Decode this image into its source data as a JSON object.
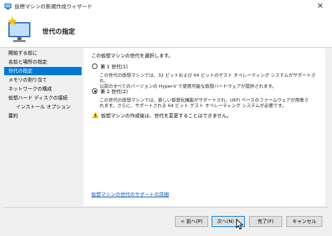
{
  "window": {
    "title": "仮想マシンの新規作成ウィザード",
    "close": "✕"
  },
  "header": {
    "title": "世代の指定"
  },
  "sidebar": {
    "items": [
      {
        "label": "開始する前に"
      },
      {
        "label": "名前と場所の指定"
      },
      {
        "label": "世代の指定"
      },
      {
        "label": "メモリの割り当て"
      },
      {
        "label": "ネットワークの構成"
      },
      {
        "label": "仮想ハード ディスクの接続"
      },
      {
        "label": "インストール オプション"
      },
      {
        "label": "要約"
      }
    ],
    "active_label": "世代の指定"
  },
  "main": {
    "intro": "この仮想マシンの世代を選択します。",
    "gen1": {
      "label": "第 1 世代(1)",
      "selected": false,
      "desc_line1": "この世代の仮想マシンでは、32 ビットおよび 64 ビットのゲスト オペレーティング システムがサポートされ、",
      "desc_line2": "以前のすべてのバージョンの Hyper-V で使用可能な仮想ハードウェアが提供されます。"
    },
    "gen2": {
      "label": "第 2 世代(2)",
      "selected": true,
      "desc_line1": "この世代の仮想マシンでは、新しい仮想化機能がサポートされ、UEFI ベースのファームウェアが用意さ",
      "desc_line2": "れます。さらに、サポートされる 64 ビット ゲスト オペレーティング システムが必要です。"
    },
    "warning": "仮想マシンの作成後は、世代を変更することはできません。",
    "link": "仮想マシンの世代のサポートの詳細"
  },
  "buttons": {
    "prev": "< 前へ(P)",
    "next": "次へ(N) >",
    "finish": "完了(F)",
    "cancel": "キャンセル"
  },
  "colors": {
    "accent": "#0078d7",
    "link": "#0055b3",
    "warning": "#f2c200"
  }
}
